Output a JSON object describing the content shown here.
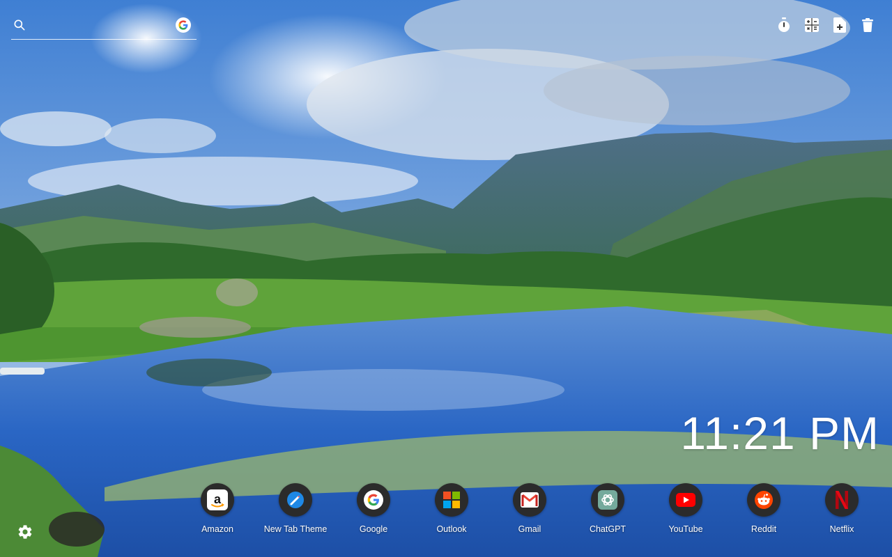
{
  "search": {
    "placeholder": "",
    "engine_icon": "google-icon",
    "search_icon": "search-icon"
  },
  "tools": [
    {
      "name": "timer-icon"
    },
    {
      "name": "calculator-icon"
    },
    {
      "name": "add-note-icon"
    },
    {
      "name": "trash-icon"
    }
  ],
  "clock": {
    "time": "11:21 PM"
  },
  "shortcuts": [
    {
      "label": "Amazon",
      "icon": "amazon-icon"
    },
    {
      "label": "New Tab Theme",
      "icon": "new-tab-theme-icon"
    },
    {
      "label": "Google",
      "icon": "google-icon"
    },
    {
      "label": "Outlook",
      "icon": "outlook-icon"
    },
    {
      "label": "Gmail",
      "icon": "gmail-icon"
    },
    {
      "label": "ChatGPT",
      "icon": "chatgpt-icon"
    },
    {
      "label": "YouTube",
      "icon": "youtube-icon"
    },
    {
      "label": "Reddit",
      "icon": "reddit-icon"
    },
    {
      "label": "Netflix",
      "icon": "netflix-icon"
    }
  ],
  "settings": {
    "icon": "gear-icon"
  },
  "colors": {
    "shortcut_bg": "#2b2b2b",
    "sky_top": "#3f7fd3",
    "water": "#2a66c4",
    "youtube_red": "#ff0000",
    "netflix_red": "#e50914",
    "reddit_orange": "#ff4500",
    "chatgpt_teal": "#74aa9c"
  }
}
